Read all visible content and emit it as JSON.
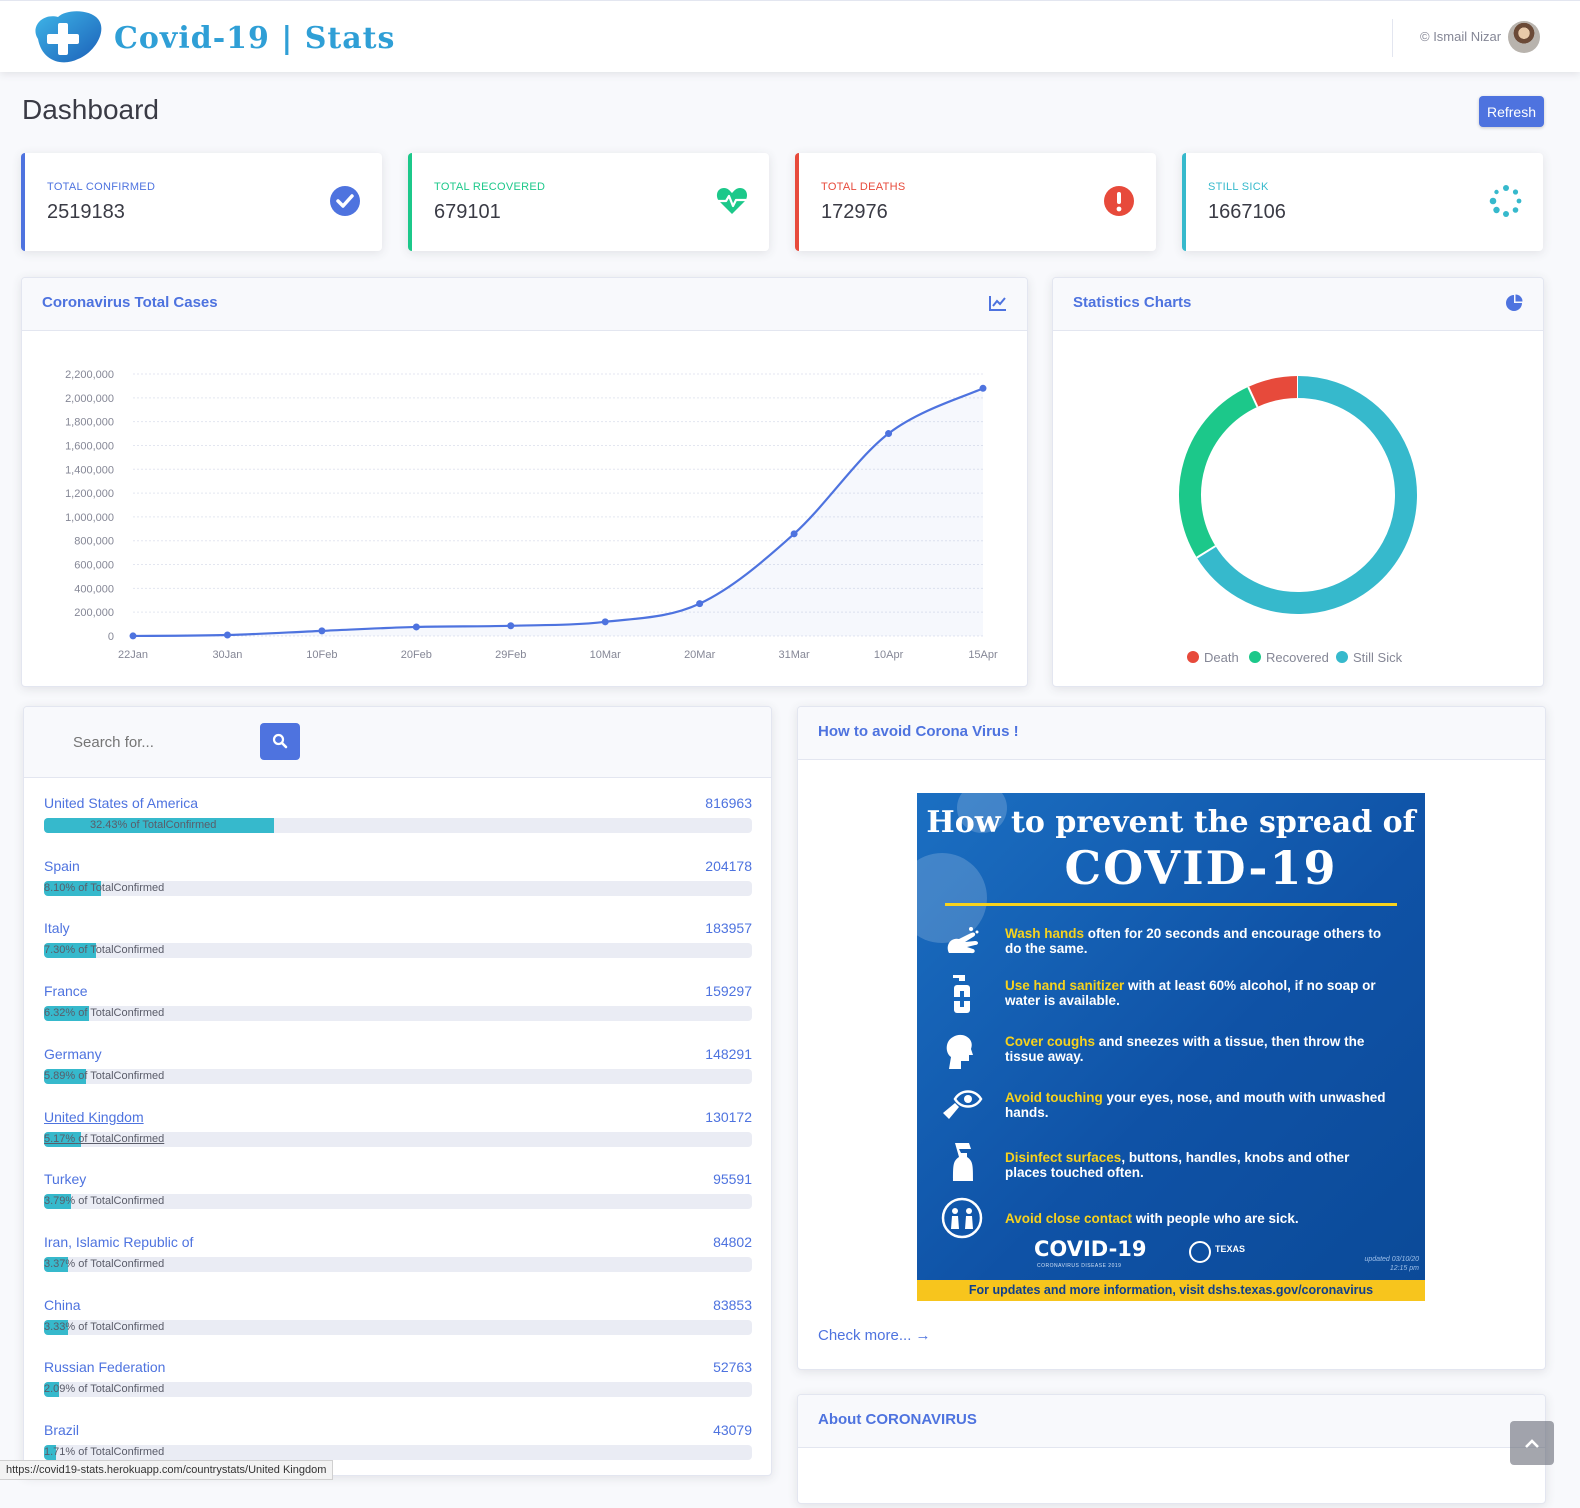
{
  "header": {
    "brand": "Covid-19 | Stats",
    "user": "© Ismail Nizar"
  },
  "page": {
    "title": "Dashboard",
    "refresh_label": "Refresh"
  },
  "colors": {
    "primary": "#4e73df",
    "success": "#1cc88a",
    "danger": "#e74a3b",
    "info": "#36b9cc"
  },
  "stats": [
    {
      "label": "TOTAL CONFIRMED",
      "value": "2519183",
      "color": "#4e73df",
      "icon": "check-circle-icon"
    },
    {
      "label": "TOTAL RECOVERED",
      "value": "679101",
      "color": "#1cc88a",
      "icon": "heartbeat-icon"
    },
    {
      "label": "TOTAL DEATHS",
      "value": "172976",
      "color": "#e74a3b",
      "icon": "exclamation-circle-icon"
    },
    {
      "label": "STILL SICK",
      "value": "1667106",
      "color": "#36b9cc",
      "icon": "spinner-icon"
    }
  ],
  "line_panel": {
    "title": "Coronavirus Total Cases",
    "icon": "chart-line-icon"
  },
  "pie_panel": {
    "title": "Statistics Charts",
    "icon": "chart-pie-icon"
  },
  "chart_data": [
    {
      "type": "line",
      "categories": [
        "22Jan",
        "30Jan",
        "10Feb",
        "20Feb",
        "29Feb",
        "10Mar",
        "20Mar",
        "31Mar",
        "10Apr",
        "15Apr"
      ],
      "values": [
        555,
        8200,
        43000,
        76000,
        86000,
        119000,
        272000,
        858000,
        1700000,
        2080000
      ],
      "y_ticks": [
        "0",
        "200,000",
        "400,000",
        "600,000",
        "800,000",
        "1,000,000",
        "1,200,000",
        "1,400,000",
        "1,600,000",
        "1,800,000",
        "2,000,000",
        "2,200,000"
      ],
      "ylim": [
        0,
        2200000
      ],
      "grid": true,
      "color": "#4e73df"
    },
    {
      "type": "pie",
      "donut": true,
      "labels": [
        "Death",
        "Recovered",
        "Still Sick"
      ],
      "values": [
        172976,
        679101,
        1667106
      ],
      "colors": [
        "#e74a3b",
        "#1cc88a",
        "#36b9cc"
      ],
      "legend": "bottom"
    }
  ],
  "search": {
    "placeholder": "Search for..."
  },
  "countries_suffix": "of TotalConfirmed",
  "countries": [
    {
      "name": "United States of America",
      "count": "816963",
      "percent": 32.43,
      "percent_label": "32.43%"
    },
    {
      "name": "Spain",
      "count": "204178",
      "percent": 8.1,
      "percent_label": "8.10%"
    },
    {
      "name": "Italy",
      "count": "183957",
      "percent": 7.3,
      "percent_label": "7.30%"
    },
    {
      "name": "France",
      "count": "159297",
      "percent": 6.32,
      "percent_label": "6.32%"
    },
    {
      "name": "Germany",
      "count": "148291",
      "percent": 5.89,
      "percent_label": "5.89%"
    },
    {
      "name": "United Kingdom",
      "count": "130172",
      "percent": 5.17,
      "percent_label": "5.17%"
    },
    {
      "name": "Turkey",
      "count": "95591",
      "percent": 3.79,
      "percent_label": "3.79%"
    },
    {
      "name": "Iran, Islamic Republic of",
      "count": "84802",
      "percent": 3.37,
      "percent_label": "3.37%"
    },
    {
      "name": "China",
      "count": "83853",
      "percent": 3.33,
      "percent_label": "3.33%"
    },
    {
      "name": "Russian Federation",
      "count": "52763",
      "percent": 2.09,
      "percent_label": "2.09%"
    },
    {
      "name": "Brazil",
      "count": "43079",
      "percent": 1.71,
      "percent_label": "1.71%"
    }
  ],
  "avoid_panel": {
    "title": "How to avoid Corona Virus !",
    "check_more": "Check more... →",
    "poster": {
      "heading": "How to prevent the spread of",
      "heading2": "COVID-19",
      "tips": [
        {
          "hl": "Wash hands",
          "rest": " often for 20 seconds and encourage others to do the same.",
          "icon": "hand-wash-icon"
        },
        {
          "hl": "Use hand sanitizer",
          "rest": " with at least 60% alcohol, if no soap or water is available.",
          "icon": "sanitizer-icon"
        },
        {
          "hl": "Cover coughs",
          "rest": " and sneezes with a tissue, then throw the tissue away.",
          "icon": "cough-icon"
        },
        {
          "hl": "Avoid touching",
          "rest": " your eyes, nose, and mouth with unwashed hands.",
          "icon": "eye-touch-icon"
        },
        {
          "hl": "Disinfect surfaces",
          "rest": ", buttons, handles, knobs and other places touched often.",
          "icon": "spray-bottle-icon"
        },
        {
          "hl": "Avoid close contact",
          "rest": " with people who are sick.",
          "icon": "people-distance-icon"
        }
      ],
      "logo": "COVID-19",
      "logo_sub": "CORONAVIRUS DISEASE 2019",
      "dept": "TEXAS",
      "updated": "updated 03/10/20\n12:15 pm",
      "footer": "For updates and more information, visit dshs.texas.gov/coronavirus"
    }
  },
  "about_panel": {
    "title": "About CORONAVIRUS"
  },
  "status_bar": {
    "url": "https://covid19-stats.herokuapp.com/countrystats/United Kingdom"
  }
}
